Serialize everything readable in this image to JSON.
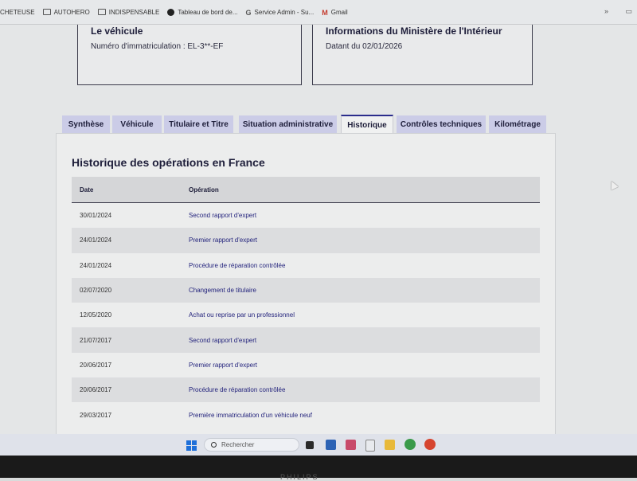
{
  "bookmarks": [
    {
      "label": "CHETEUSE",
      "icon": "none"
    },
    {
      "label": "AUTOHERO",
      "icon": "folder-icon"
    },
    {
      "label": "INDISPENSABLE",
      "icon": "folder-icon"
    },
    {
      "label": "Tableau de bord de...",
      "icon": "site-icon"
    },
    {
      "label": "Service Admin - Su...",
      "icon": "google-icon"
    },
    {
      "label": "Gmail",
      "icon": "gmail-icon"
    }
  ],
  "cards": {
    "vehicle": {
      "title": "Le véhicule",
      "subtitle": "Numéro d'immatriculation : EL-3**-EF"
    },
    "ministry": {
      "title": "Informations du Ministère de l'Intérieur",
      "subtitle": "Datant du 02/01/2026"
    }
  },
  "tabs": [
    {
      "label": "Synthèse",
      "active": false
    },
    {
      "label": "Véhicule",
      "active": false
    },
    {
      "label": "Titulaire et Titre",
      "active": false
    },
    {
      "label": "Situation administrative",
      "active": false
    },
    {
      "label": "Historique",
      "active": true
    },
    {
      "label": "Contrôles techniques",
      "active": false
    },
    {
      "label": "Kilométrage",
      "active": false
    }
  ],
  "history": {
    "title": "Historique des opérations en France",
    "columns": [
      "Date",
      "Opération"
    ],
    "rows": [
      {
        "date": "30/01/2024",
        "operation": "Second rapport d'expert"
      },
      {
        "date": "24/01/2024",
        "operation": "Premier rapport d'expert"
      },
      {
        "date": "24/01/2024",
        "operation": "Procédure de réparation contrôlée"
      },
      {
        "date": "02/07/2020",
        "operation": "Changement de titulaire"
      },
      {
        "date": "12/05/2020",
        "operation": "Achat ou reprise par un professionnel"
      },
      {
        "date": "21/07/2017",
        "operation": "Second rapport d'expert"
      },
      {
        "date": "20/06/2017",
        "operation": "Premier rapport d'expert"
      },
      {
        "date": "20/06/2017",
        "operation": "Procédure de réparation contrôlée"
      },
      {
        "date": "29/03/2017",
        "operation": "Première immatriculation d'un véhicule neuf"
      }
    ]
  },
  "taskbar": {
    "search_placeholder": "Rechercher"
  },
  "monitor": {
    "brand": "PHILIPS"
  },
  "colors": {
    "accent": "#2b2d8c",
    "tab_bg": "#cbcce7",
    "link": "#1f1f7a"
  }
}
